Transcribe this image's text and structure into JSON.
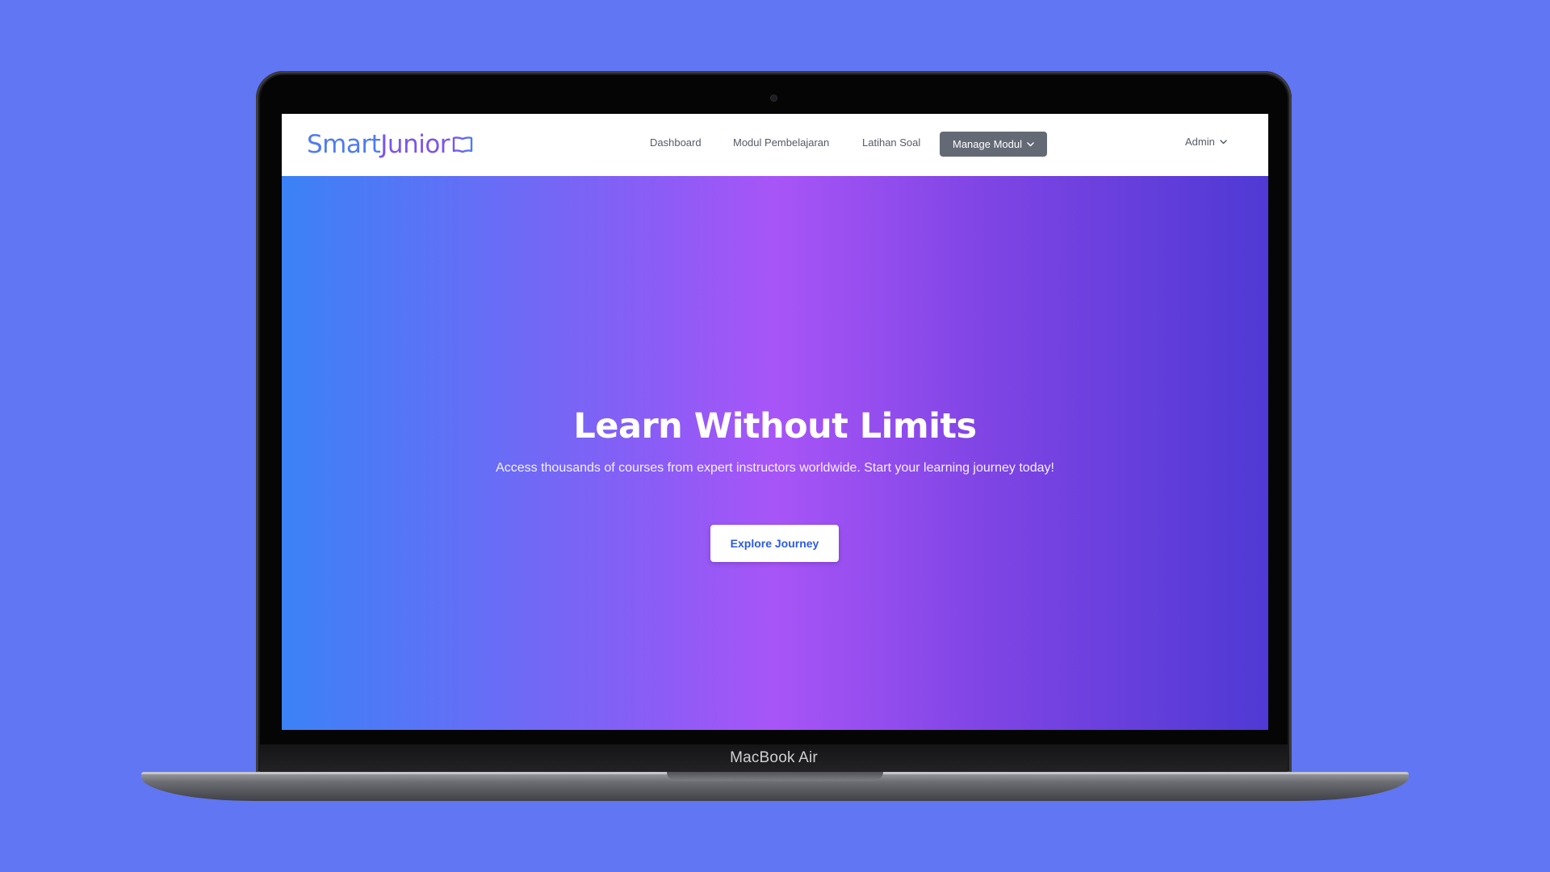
{
  "device": {
    "label": "MacBook Air"
  },
  "navbar": {
    "logo": {
      "part1": "Smart",
      "part2": "Junior",
      "icon": "open-book-icon"
    },
    "links": [
      {
        "label": "Dashboard"
      },
      {
        "label": "Modul Pembelajaran"
      },
      {
        "label": "Latihan Soal"
      }
    ],
    "manage_button": {
      "label": "Manage Modul",
      "icon": "chevron-down-icon"
    },
    "user_menu": {
      "label": "Admin",
      "icon": "chevron-down-icon"
    }
  },
  "hero": {
    "title": "Learn Without Limits",
    "subtitle": "Access thousands of courses from expert instructors worldwide. Start your learning journey today!",
    "cta_label": "Explore Journey"
  },
  "colors": {
    "page_background": "#6176f3",
    "hero_gradient": [
      "#3b82f6",
      "#a855f7",
      "#4f39d4"
    ],
    "logo_blue": "#4f7cf0",
    "logo_purple": "#7a55ee",
    "manage_button_bg": "#646a75",
    "cta_text": "#2d5be3"
  }
}
